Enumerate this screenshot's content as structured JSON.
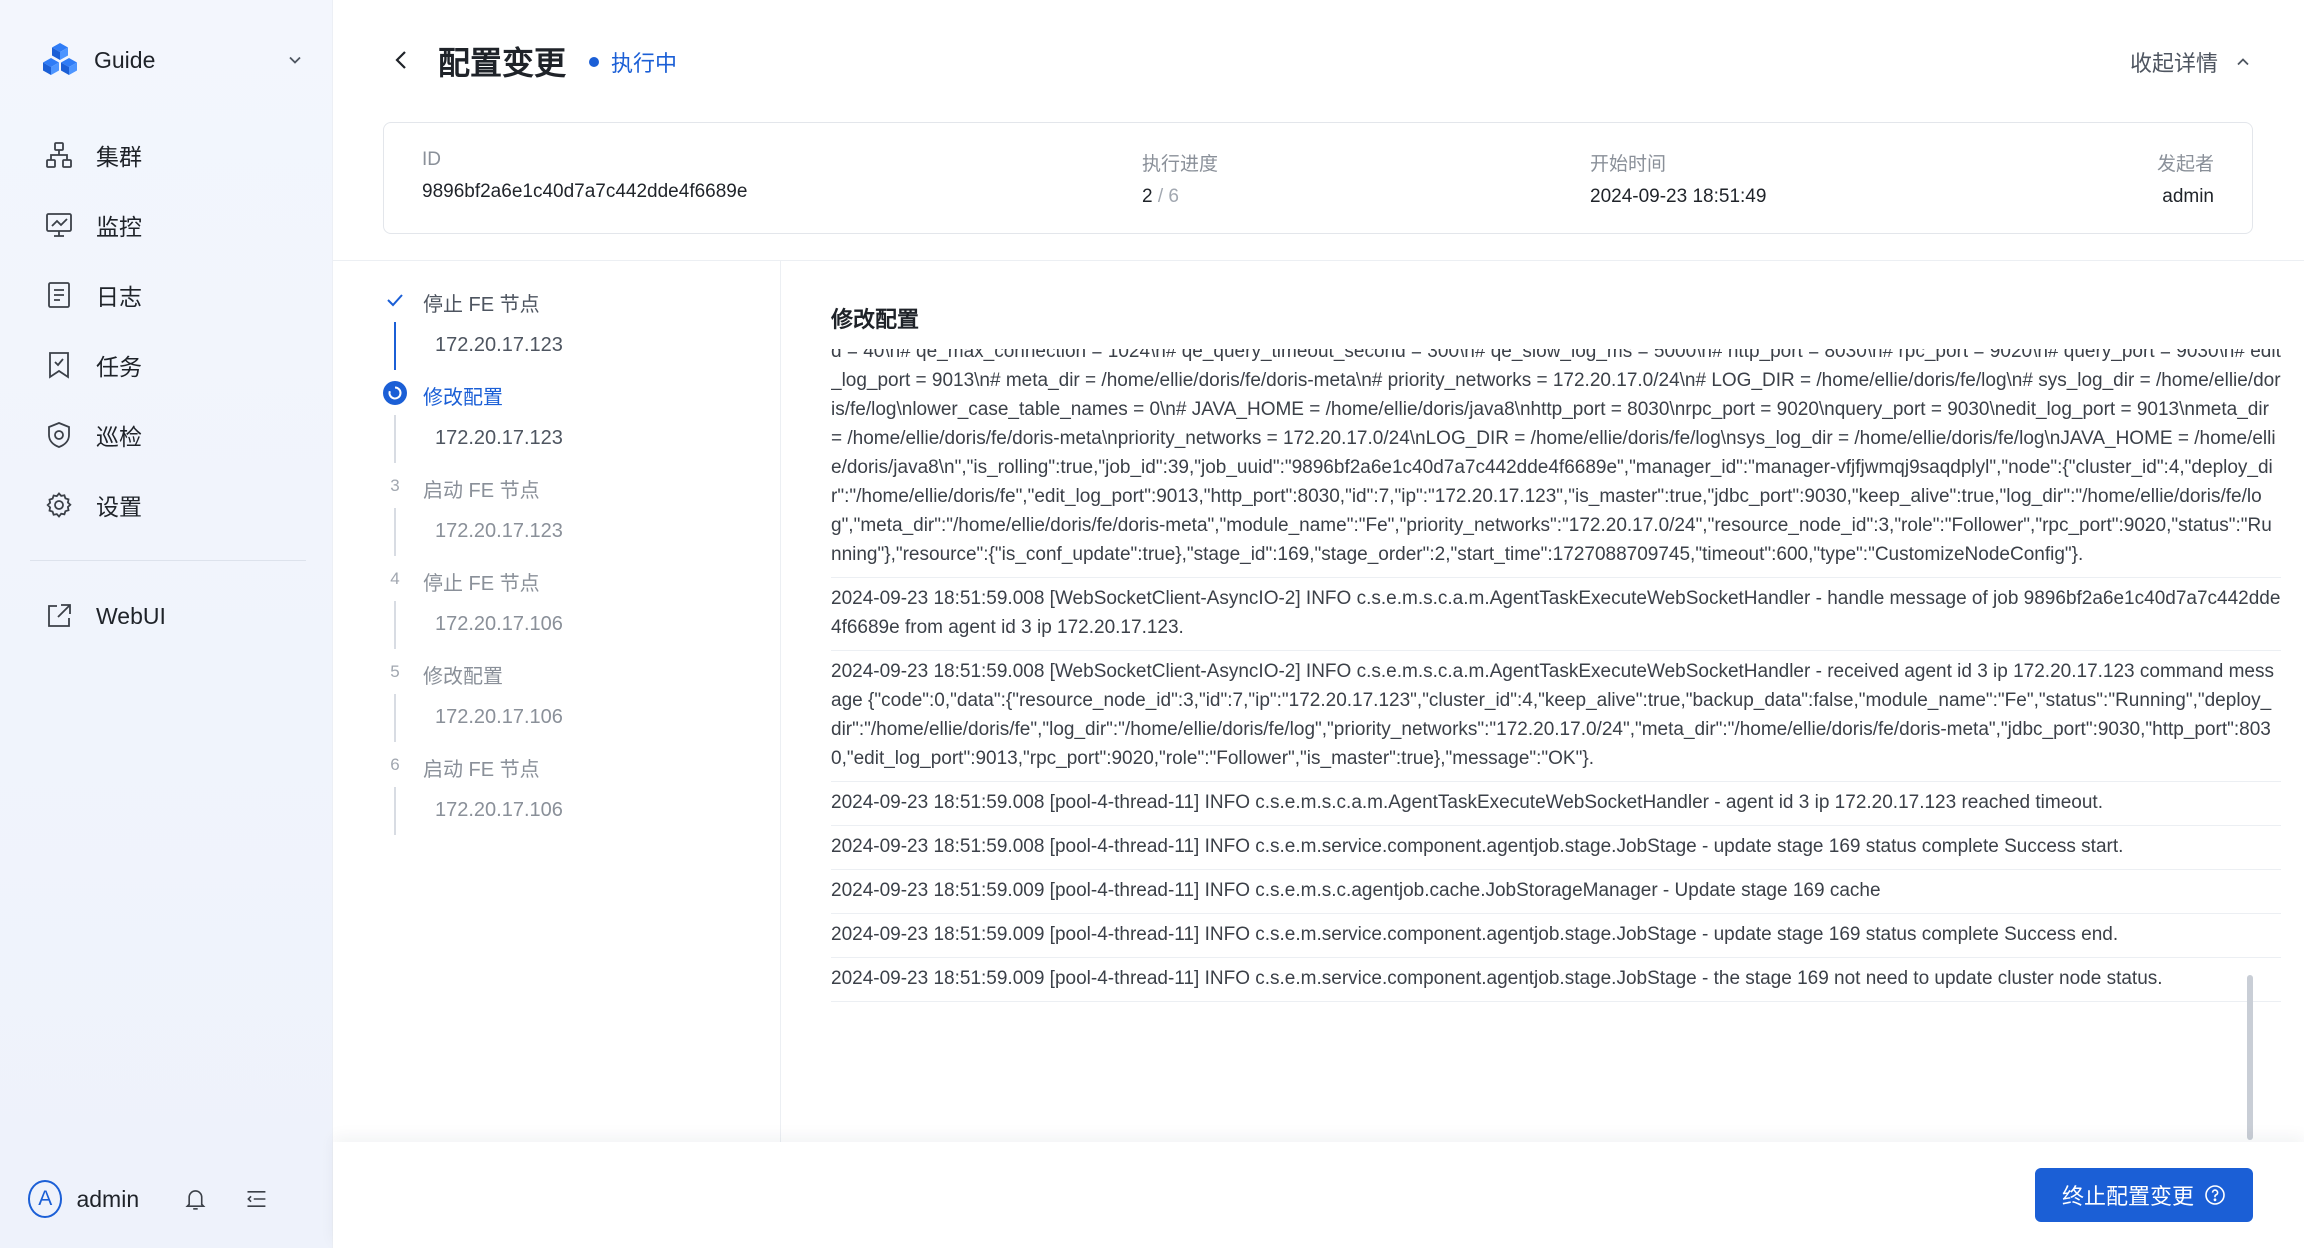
{
  "sidebar": {
    "brand": "Guide",
    "items": [
      {
        "label": "集群",
        "icon": "cluster-icon"
      },
      {
        "label": "监控",
        "icon": "monitor-icon"
      },
      {
        "label": "日志",
        "icon": "log-icon"
      },
      {
        "label": "任务",
        "icon": "task-icon"
      },
      {
        "label": "巡检",
        "icon": "inspect-icon"
      },
      {
        "label": "设置",
        "icon": "settings-icon"
      }
    ],
    "webui": {
      "label": "WebUI",
      "icon": "external-link-icon"
    },
    "user": {
      "avatar_letter": "A",
      "name": "admin"
    }
  },
  "header": {
    "title": "配置变更",
    "status": "执行中",
    "collapse_label": "收起详情"
  },
  "info": {
    "id_label": "ID",
    "id_value": "9896bf2a6e1c40d7a7c442dde4f6689e",
    "progress_label": "执行进度",
    "progress_current": "2",
    "progress_total": "6",
    "start_label": "开始时间",
    "start_value": "2024-09-23 18:51:49",
    "initiator_label": "发起者",
    "initiator_value": "admin"
  },
  "steps": [
    {
      "number": "1",
      "title": "停止 FE 节点",
      "ip": "172.20.17.123",
      "state": "done"
    },
    {
      "number": "2",
      "title": "修改配置",
      "ip": "172.20.17.123",
      "state": "active"
    },
    {
      "number": "3",
      "title": "启动 FE 节点",
      "ip": "172.20.17.123",
      "state": "pending"
    },
    {
      "number": "4",
      "title": "停止 FE 节点",
      "ip": "172.20.17.106",
      "state": "pending"
    },
    {
      "number": "5",
      "title": "修改配置",
      "ip": "172.20.17.106",
      "state": "pending"
    },
    {
      "number": "6",
      "title": "启动 FE 节点",
      "ip": "172.20.17.106",
      "state": "pending"
    }
  ],
  "log": {
    "title": "修改配置",
    "entries": [
      "d = 40\\n# qe_max_connection = 1024\\n# qe_query_timeout_second = 300\\n# qe_slow_log_ms = 5000\\n# http_port = 8030\\n# rpc_port = 9020\\n# query_port = 9030\\n# edit_log_port = 9013\\n# meta_dir = /home/ellie/doris/fe/doris-meta\\n# priority_networks = 172.20.17.0/24\\n# LOG_DIR = /home/ellie/doris/fe/log\\n# sys_log_dir = /home/ellie/doris/fe/log\\nlower_case_table_names = 0\\n# JAVA_HOME = /home/ellie/doris/java8\\nhttp_port = 8030\\nrpc_port = 9020\\nquery_port = 9030\\nedit_log_port = 9013\\nmeta_dir = /home/ellie/doris/fe/doris-meta\\npriority_networks = 172.20.17.0/24\\nLOG_DIR = /home/ellie/doris/fe/log\\nsys_log_dir = /home/ellie/doris/fe/log\\nJAVA_HOME = /home/ellie/doris/java8\\n\",\"is_rolling\":true,\"job_id\":39,\"job_uuid\":\"9896bf2a6e1c40d7a7c442dde4f6689e\",\"manager_id\":\"manager-vfjfjwmqj9saqdplyl\",\"node\":{\"cluster_id\":4,\"deploy_dir\":\"/home/ellie/doris/fe\",\"edit_log_port\":9013,\"http_port\":8030,\"id\":7,\"ip\":\"172.20.17.123\",\"is_master\":true,\"jdbc_port\":9030,\"keep_alive\":true,\"log_dir\":\"/home/ellie/doris/fe/log\",\"meta_dir\":\"/home/ellie/doris/fe/doris-meta\",\"module_name\":\"Fe\",\"priority_networks\":\"172.20.17.0/24\",\"resource_node_id\":3,\"role\":\"Follower\",\"rpc_port\":9020,\"status\":\"Running\"},\"resource\":{\"is_conf_update\":true},\"stage_id\":169,\"stage_order\":2,\"start_time\":1727088709745,\"timeout\":600,\"type\":\"CustomizeNodeConfig\"}.",
      "2024-09-23 18:51:59.008 [WebSocketClient-AsyncIO-2] INFO  c.s.e.m.s.c.a.m.AgentTaskExecuteWebSocketHandler - handle message of job 9896bf2a6e1c40d7a7c442dde4f6689e from agent id 3 ip 172.20.17.123.",
      "2024-09-23 18:51:59.008 [WebSocketClient-AsyncIO-2] INFO  c.s.e.m.s.c.a.m.AgentTaskExecuteWebSocketHandler - received agent id 3 ip 172.20.17.123 command message {\"code\":0,\"data\":{\"resource_node_id\":3,\"id\":7,\"ip\":\"172.20.17.123\",\"cluster_id\":4,\"keep_alive\":true,\"backup_data\":false,\"module_name\":\"Fe\",\"status\":\"Running\",\"deploy_dir\":\"/home/ellie/doris/fe\",\"log_dir\":\"/home/ellie/doris/fe/log\",\"priority_networks\":\"172.20.17.0/24\",\"meta_dir\":\"/home/ellie/doris/fe/doris-meta\",\"jdbc_port\":9030,\"http_port\":8030,\"edit_log_port\":9013,\"rpc_port\":9020,\"role\":\"Follower\",\"is_master\":true},\"message\":\"OK\"}.",
      "2024-09-23 18:51:59.008 [pool-4-thread-11] INFO  c.s.e.m.s.c.a.m.AgentTaskExecuteWebSocketHandler - agent id 3 ip 172.20.17.123 reached timeout.",
      "2024-09-23 18:51:59.008 [pool-4-thread-11] INFO  c.s.e.m.service.component.agentjob.stage.JobStage - update stage 169 status complete Success start.",
      "2024-09-23 18:51:59.009 [pool-4-thread-11] INFO  c.s.e.m.s.c.agentjob.cache.JobStorageManager - Update stage 169 cache",
      "2024-09-23 18:51:59.009 [pool-4-thread-11] INFO  c.s.e.m.service.component.agentjob.stage.JobStage - update stage 169 status complete Success end.",
      "2024-09-23 18:51:59.009 [pool-4-thread-11] INFO  c.s.e.m.service.component.agentjob.stage.JobStage - the stage 169 not need to update cluster node status."
    ]
  },
  "footer": {
    "stop_label": "终止配置变更"
  },
  "colors": {
    "accent": "#1b5fd6",
    "sidebar_bg": "#f1f4fc"
  }
}
